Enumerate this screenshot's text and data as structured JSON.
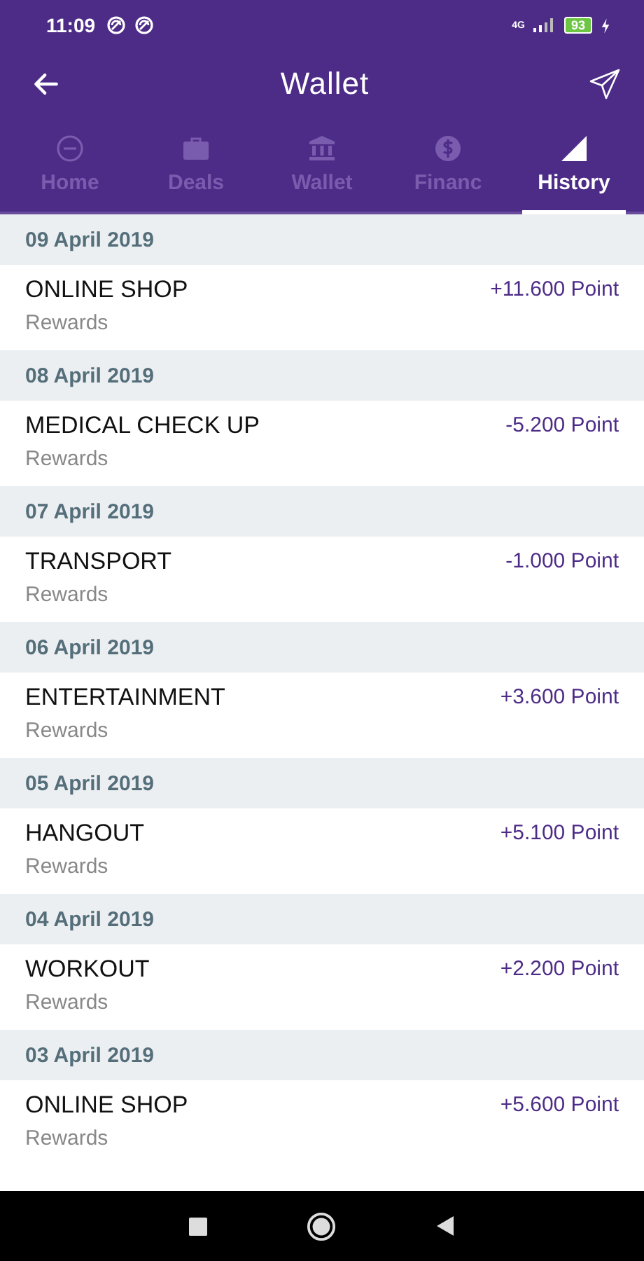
{
  "status_bar": {
    "time": "11:09",
    "network": "4G",
    "battery": "93"
  },
  "app_bar": {
    "title": "Wallet"
  },
  "tabs": [
    {
      "label": "Home",
      "kind": "minus-circle",
      "selected": false
    },
    {
      "label": "Deals",
      "kind": "briefcase",
      "selected": false
    },
    {
      "label": "Wallet",
      "kind": "bank",
      "selected": false
    },
    {
      "label": "Financ",
      "kind": "dollar",
      "selected": false
    },
    {
      "label": "History",
      "kind": "triangle",
      "selected": true
    }
  ],
  "history": [
    {
      "date": "09 April 2019",
      "title": "ONLINE SHOP",
      "subtitle": "Rewards",
      "amount": "+11.600 Point"
    },
    {
      "date": "08 April 2019",
      "title": "MEDICAL CHECK UP",
      "subtitle": "Rewards",
      "amount": "-5.200 Point"
    },
    {
      "date": "07 April 2019",
      "title": "TRANSPORT",
      "subtitle": "Rewards",
      "amount": "-1.000 Point"
    },
    {
      "date": "06 April 2019",
      "title": "ENTERTAINMENT",
      "subtitle": "Rewards",
      "amount": "+3.600 Point"
    },
    {
      "date": "05 April 2019",
      "title": "HANGOUT",
      "subtitle": "Rewards",
      "amount": "+5.100 Point"
    },
    {
      "date": "04 April 2019",
      "title": "WORKOUT",
      "subtitle": "Rewards",
      "amount": "+2.200 Point"
    },
    {
      "date": "03 April 2019",
      "title": "ONLINE SHOP",
      "subtitle": "Rewards",
      "amount": "+5.600 Point"
    }
  ]
}
